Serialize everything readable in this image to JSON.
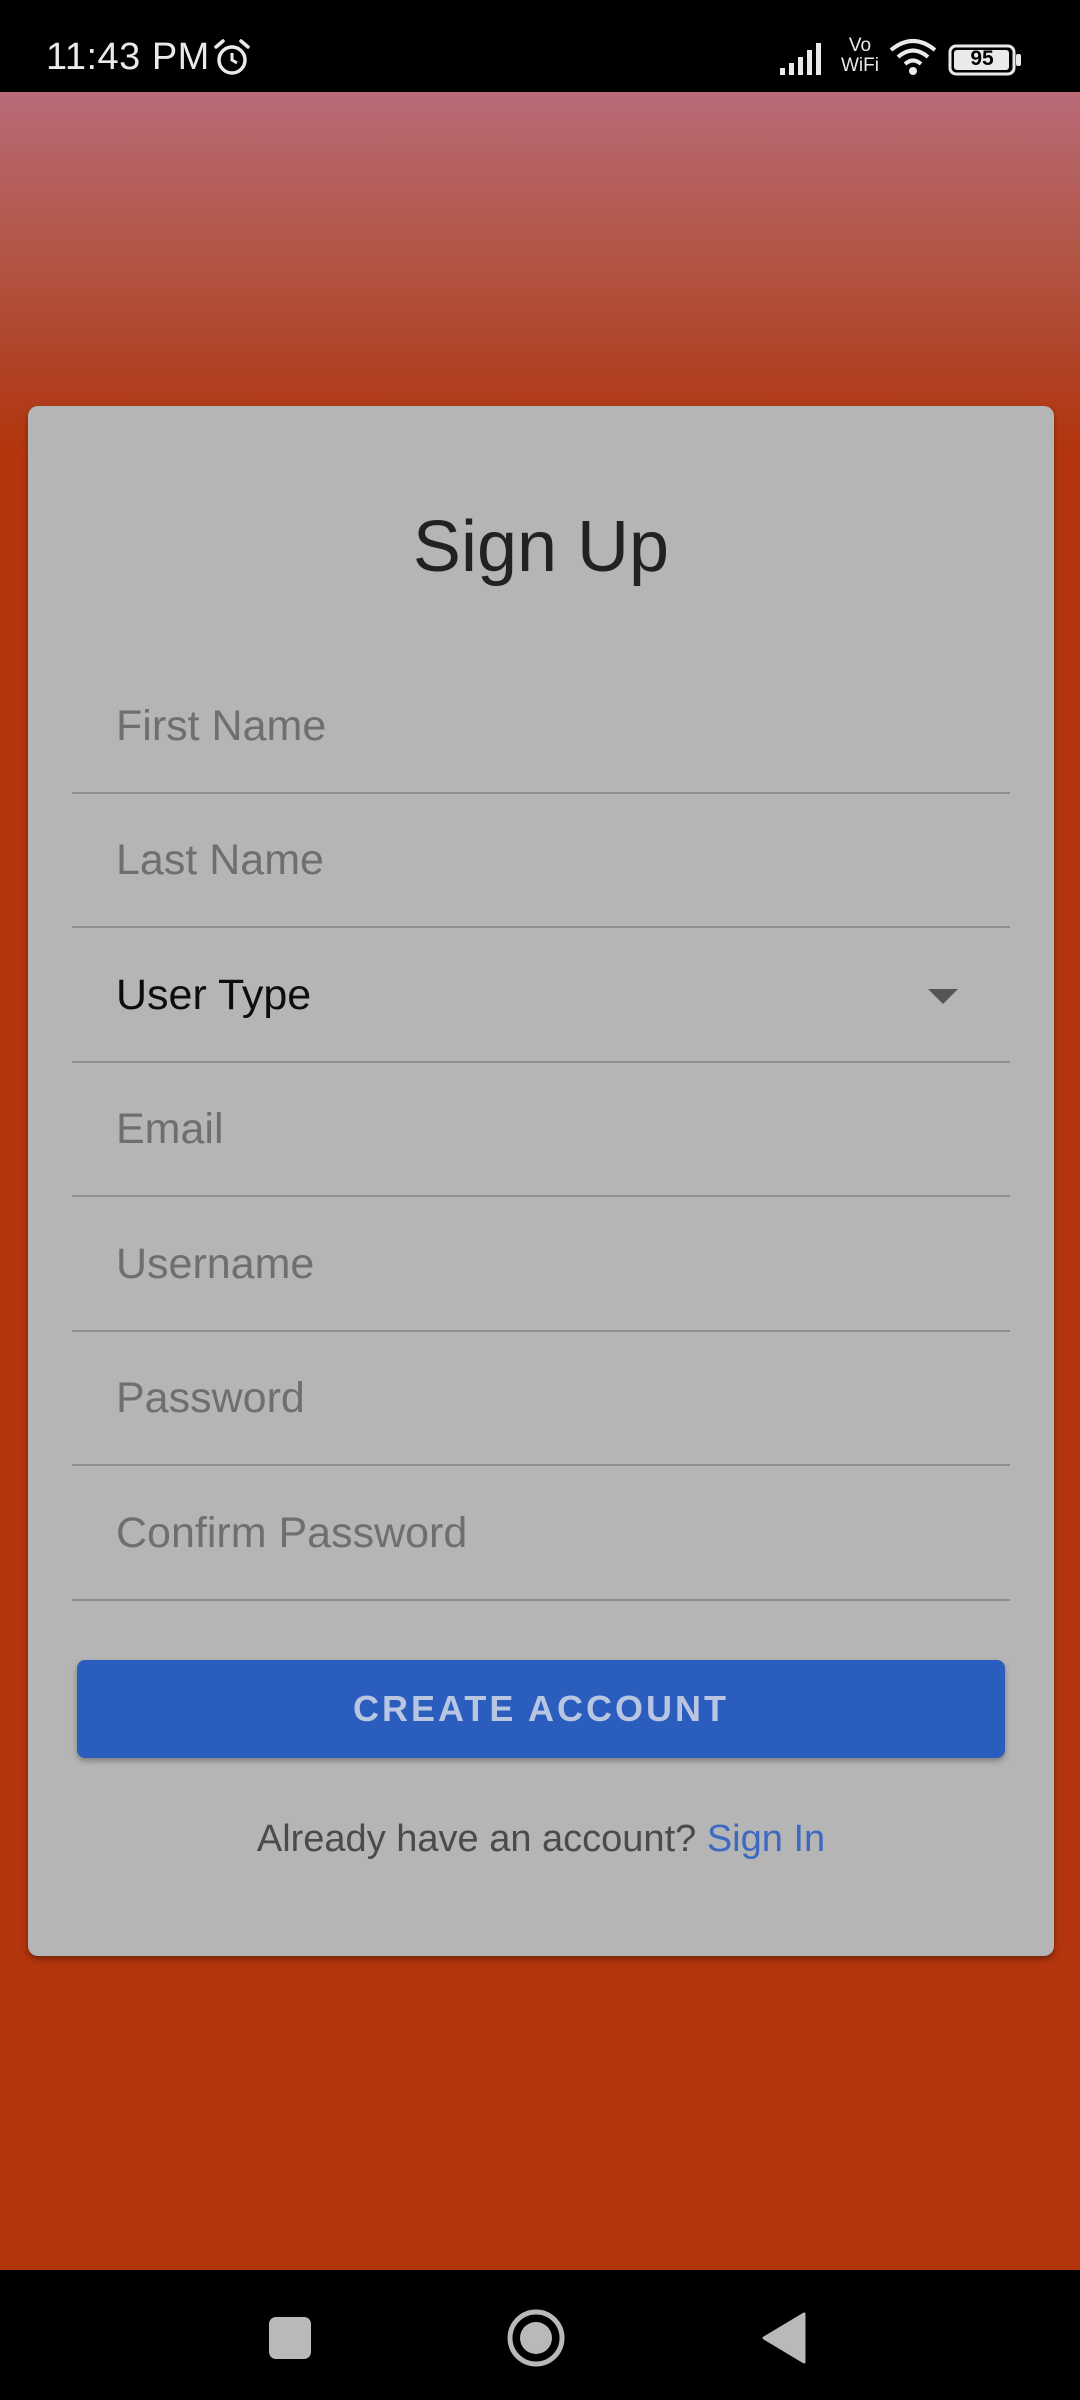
{
  "status_bar": {
    "time": "11:43 PM",
    "vowifi": "Vo WiFi",
    "battery": "95",
    "icons": [
      "alarm-icon",
      "signal-icon",
      "wifi-icon",
      "battery-icon"
    ]
  },
  "signup": {
    "title": "Sign Up",
    "fields": {
      "first_name_placeholder": "First Name",
      "last_name_placeholder": "Last Name",
      "user_type_value": "User Type",
      "email_placeholder": "Email",
      "username_placeholder": "Username",
      "password_placeholder": "Password",
      "confirm_password_placeholder": "Confirm Password"
    },
    "create_button_label": "CREATE ACCOUNT",
    "signin_prompt": "Already have an account?",
    "signin_link": "Sign In"
  },
  "nav_bar": {
    "icons": [
      "recent-apps-icon",
      "home-icon",
      "back-icon"
    ]
  },
  "colors": {
    "background_top": "#b96a78",
    "background_main": "#b2350c",
    "card": "#b5b5b5",
    "button": "#2a5dbe",
    "link": "#3d6ac0"
  }
}
